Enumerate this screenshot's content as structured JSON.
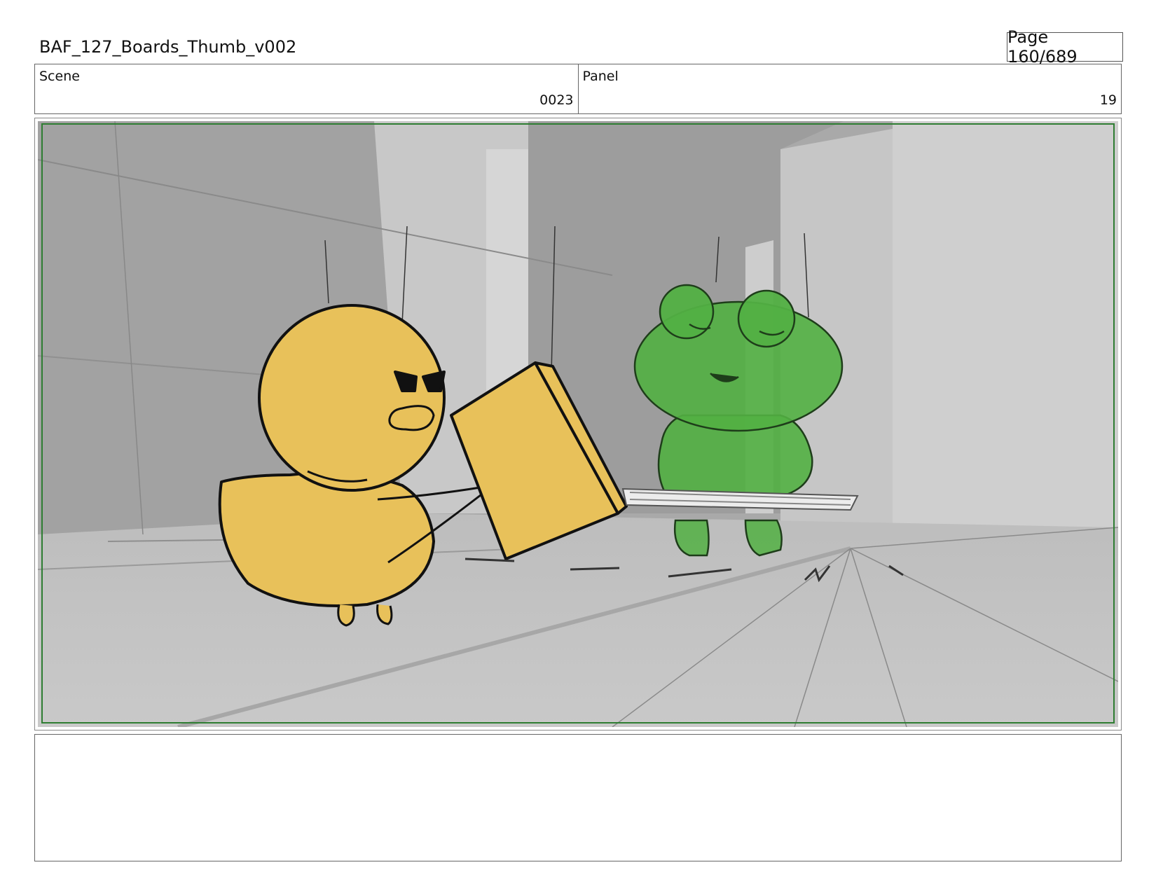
{
  "header": {
    "title": "BAF_127_Boards_Thumb_v002",
    "page_label": "Page 160/689"
  },
  "info": {
    "scene_label": "Scene",
    "scene_value": "0023",
    "panel_label": "Panel",
    "panel_value": "19"
  },
  "colors": {
    "safe_frame": "#2e7d32",
    "duck_fill": "#e8c15a",
    "frog_fill": "#52b043"
  },
  "notes": {
    "text": ""
  }
}
